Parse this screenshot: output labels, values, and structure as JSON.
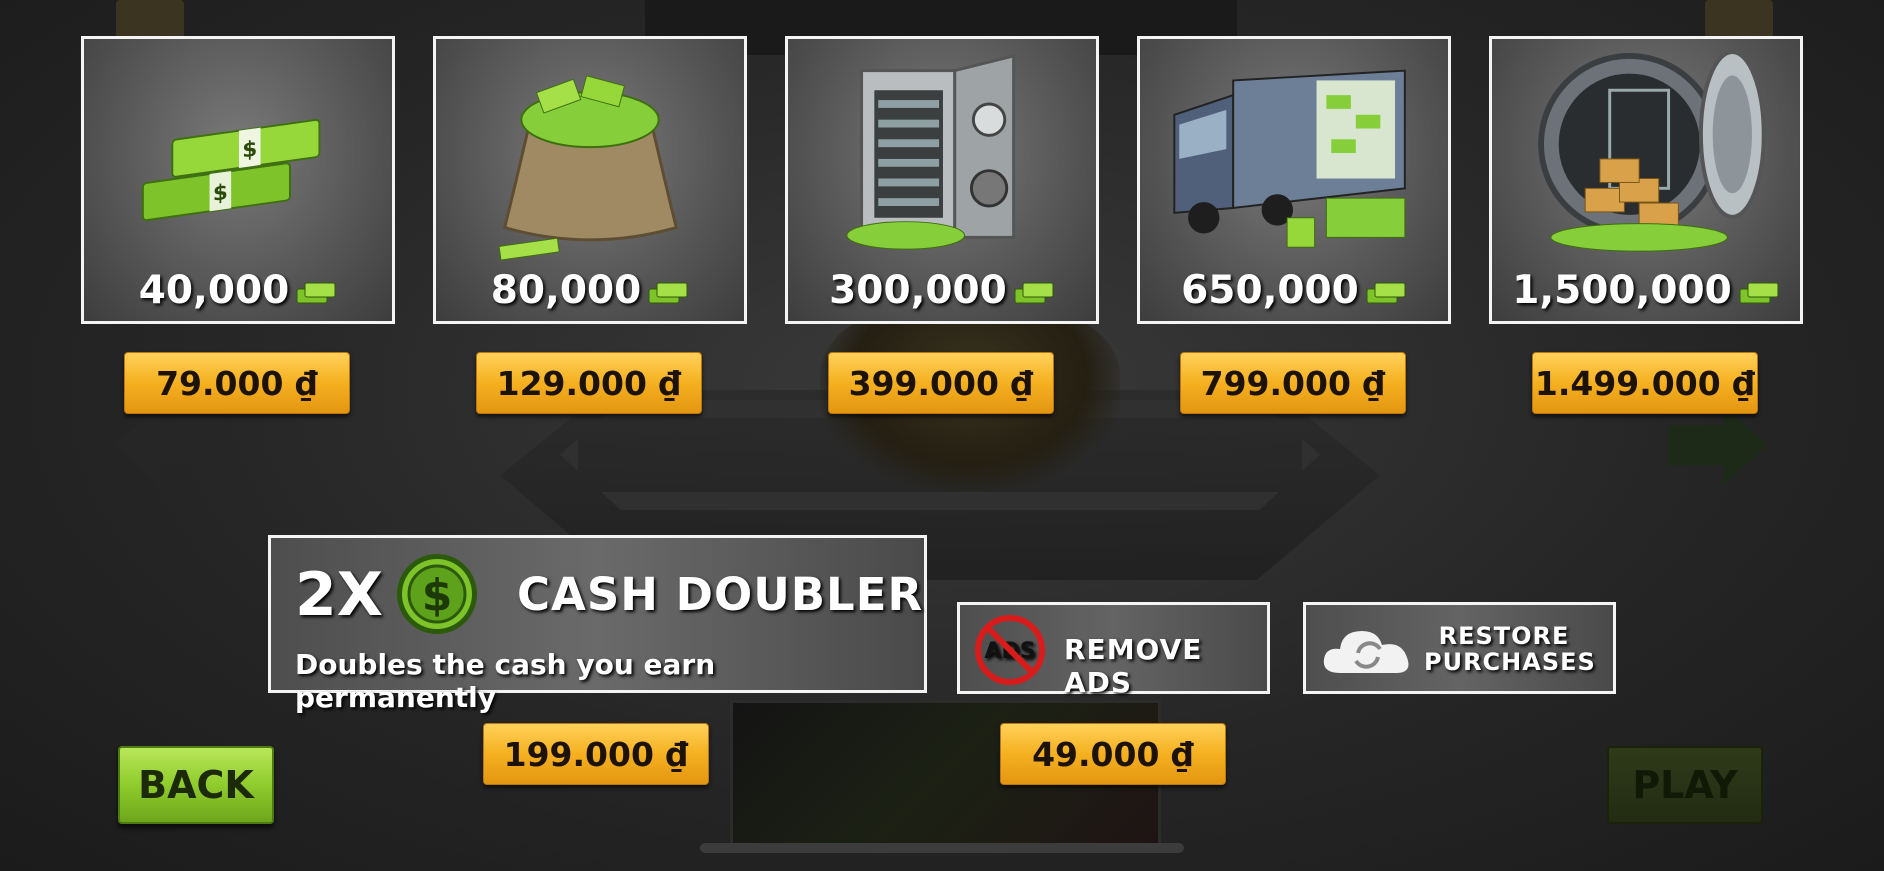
{
  "packs": [
    {
      "amount": "40,000",
      "price": "79.000 ₫",
      "art": "cash-stack-icon"
    },
    {
      "amount": "80,000",
      "price": "129.000 ₫",
      "art": "money-bag-icon"
    },
    {
      "amount": "300,000",
      "price": "399.000 ₫",
      "art": "safe-icon"
    },
    {
      "amount": "650,000",
      "price": "799.000 ₫",
      "art": "armored-truck-icon"
    },
    {
      "amount": "1,500,000",
      "price": "1.499.000 ₫",
      "art": "vault-icon"
    }
  ],
  "doubler": {
    "multiplier": "2X",
    "title": "CASH DOUBLER",
    "description": "Doubles the cash you earn permanently",
    "price": "199.000 ₫"
  },
  "remove_ads": {
    "label": "REMOVE ADS",
    "icon_text": "ADS",
    "price": "49.000 ₫"
  },
  "restore": {
    "line1": "RESTORE",
    "line2": "PURCHASES"
  },
  "nav": {
    "back": "BACK",
    "play": "PLAY"
  },
  "colors": {
    "price_button": "#f5b020",
    "back_button": "#8fcc2c",
    "card_border": "#f4f4f4"
  }
}
